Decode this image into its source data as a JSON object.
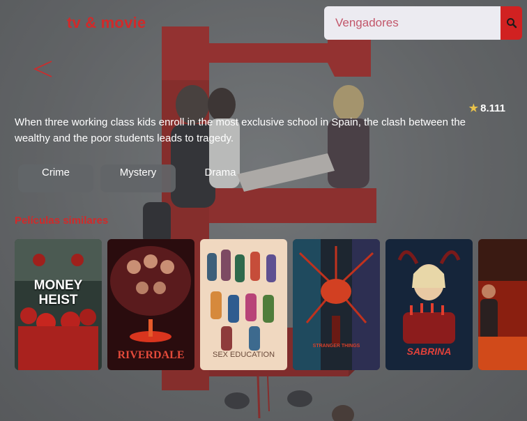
{
  "app": {
    "brand": "tv & movie"
  },
  "search": {
    "placeholder": "Vengadores",
    "value": "",
    "button_icon": "search-icon"
  },
  "nav": {
    "back_icon": "chevron-left-icon"
  },
  "details": {
    "rating": "8.111",
    "rating_icon": "star-icon",
    "overview": "When three working class kids enroll in the most exclusive school in Spain, the clash between the wealthy and the poor students leads to tragedy.",
    "genres": [
      "Crime",
      "Mystery",
      "Drama"
    ]
  },
  "similar": {
    "title": "Películas similares",
    "items": [
      {
        "title": "MONEY\nHEIST",
        "line1": "MONEY",
        "line2": "HEIST"
      },
      {
        "title": "RIVERDALE"
      },
      {
        "title": "SEX EDUCATION"
      },
      {
        "title": "STRANGER THINGS"
      },
      {
        "title": "SABRINA"
      },
      {
        "title": ""
      }
    ]
  },
  "colors": {
    "accent": "#d12a2a",
    "search_button": "#d12121",
    "search_field": "#ecebf1",
    "placeholder": "#c2566a",
    "star": "#e9c24a",
    "genre_pill": "#626568"
  }
}
